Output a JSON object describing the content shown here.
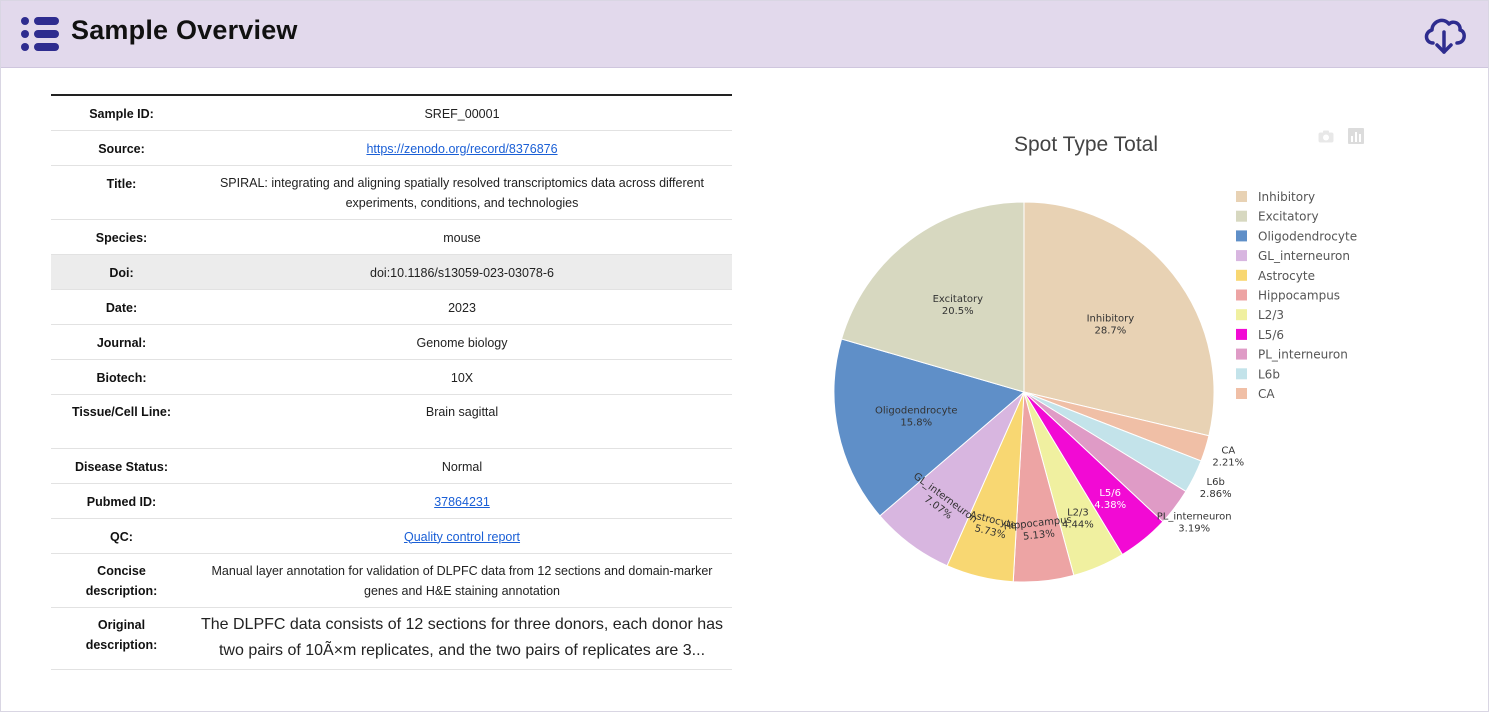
{
  "header": {
    "title": "Sample Overview",
    "menu_icon": "list-icon",
    "download_icon": "cloud-download-icon",
    "accent": "#2e2c8f",
    "background": "#e2d9ec"
  },
  "table": {
    "rows": [
      {
        "label": "Sample ID:",
        "value": "SREF_00001",
        "link": false
      },
      {
        "label": "Source:",
        "value": "https://zenodo.org/record/8376876",
        "link": true
      },
      {
        "label": "Title:",
        "value": "SPIRAL: integrating and aligning spatially resolved transcriptomics data across different experiments, conditions, and technologies",
        "link": false
      },
      {
        "label": "Species:",
        "value": "mouse",
        "link": false
      },
      {
        "label": "Doi:",
        "value": "doi:10.1186/s13059-023-03078-6",
        "link": false
      },
      {
        "label": "Date:",
        "value": "2023",
        "link": false
      },
      {
        "label": "Journal:",
        "value": "Genome biology",
        "link": false
      },
      {
        "label": "Biotech:",
        "value": "10X",
        "link": false
      },
      {
        "label": "Tissue/Cell Line:",
        "value": "Brain sagittal",
        "link": false
      },
      {
        "label": "Disease Status:",
        "value": "Normal",
        "link": false
      },
      {
        "label": "Pubmed ID:",
        "value": "37864231",
        "link": true
      },
      {
        "label": "QC:",
        "value": "Quality control report",
        "link": true
      },
      {
        "label": "Concise description:",
        "value": "Manual layer annotation for validation of DLPFC data from 12 sections and domain-marker genes and H&E staining annotation",
        "link": false
      },
      {
        "label": "Original description:",
        "value": "The DLPFC data consists of 12 sections for three donors, each donor has two pairs of 10Ã×m replicates, and the two pairs of replicates are 3...",
        "link": false
      }
    ]
  },
  "chart_tools": {
    "camera_icon": "camera-icon",
    "bar_icon": "bar-chart-icon"
  },
  "chart_data": {
    "type": "pie",
    "title": "Spot Type Total",
    "legend_position": "right",
    "slices": [
      {
        "label": "Inhibitory",
        "percent": 28.7,
        "text": "28.7%",
        "color": "#e8d2b4"
      },
      {
        "label": "CA",
        "percent": 2.21,
        "text": "2.21%",
        "color": "#f0bfa6"
      },
      {
        "label": "L6b",
        "percent": 2.86,
        "text": "2.86%",
        "color": "#c3e3ea"
      },
      {
        "label": "PL_interneuron",
        "percent": 3.19,
        "text": "3.19%",
        "color": "#df9bc6"
      },
      {
        "label": "L5/6",
        "percent": 4.38,
        "text": "4.38%",
        "color": "#f20ad4"
      },
      {
        "label": "L2/3",
        "percent": 4.44,
        "text": "4.44%",
        "color": "#f0f0a0"
      },
      {
        "label": "Hippocampus",
        "percent": 5.13,
        "text": "5.13%",
        "color": "#eda4a4"
      },
      {
        "label": "Astrocyte",
        "percent": 5.73,
        "text": "5.73%",
        "color": "#f8d772"
      },
      {
        "label": "GL_interneuron",
        "percent": 7.07,
        "text": "7.07%",
        "color": "#d8b6e0"
      },
      {
        "label": "Oligodendrocyte",
        "percent": 15.8,
        "text": "15.8%",
        "color": "#5f8fc8"
      },
      {
        "label": "Excitatory",
        "percent": 20.5,
        "text": "20.5%",
        "color": "#d7d8c0"
      }
    ],
    "legend": [
      "Inhibitory",
      "Excitatory",
      "Oligodendrocyte",
      "GL_interneuron",
      "Astrocyte",
      "Hippocampus",
      "L2/3",
      "L5/6",
      "PL_interneuron",
      "L6b",
      "CA"
    ]
  }
}
